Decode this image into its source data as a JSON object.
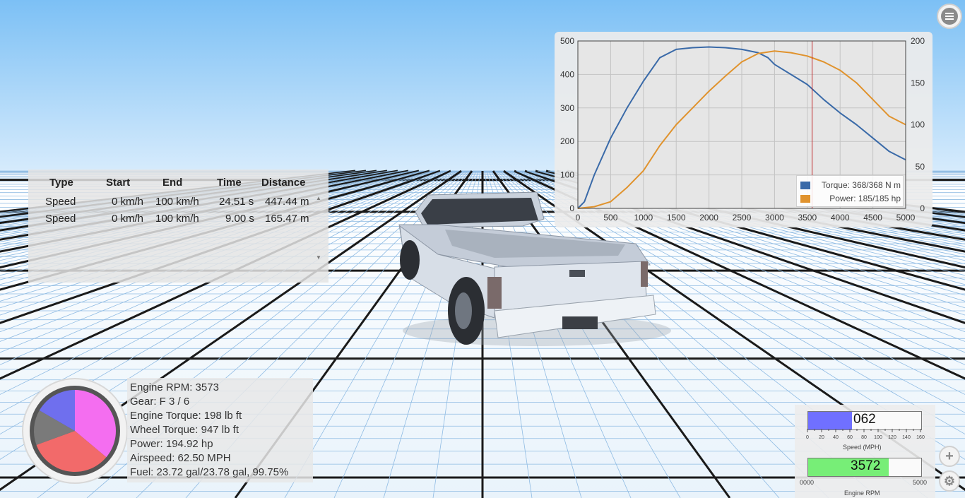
{
  "colors": {
    "sky_top": "#7cc0f5",
    "sky_bottom": "#cfe7fb",
    "ground": "#f2f8fd",
    "torque": "#3a6aa8",
    "power": "#e0932e",
    "speed_fill": "#7070ff",
    "rpm_fill": "#77ee77"
  },
  "menu": {
    "icon": "hamburger-menu-icon"
  },
  "torque_chart": {
    "chart_data": {
      "type": "line",
      "x_range": [
        0,
        5000
      ],
      "x_ticks": [
        "0",
        "500",
        "1000",
        "1500",
        "2000",
        "2500",
        "3000",
        "3500",
        "4000",
        "4500",
        "5000"
      ],
      "y_left_range": [
        0,
        500
      ],
      "y_left_ticks": [
        "0",
        "100",
        "200",
        "300",
        "400",
        "500"
      ],
      "y_right_range": [
        0,
        200
      ],
      "y_right_ticks": [
        "0",
        "50",
        "100",
        "150",
        "200"
      ],
      "grid": true,
      "marker_x": 3573,
      "legend_position": "bottom-right",
      "series": [
        {
          "name": "Torque: 368/368 N m",
          "axis": "left",
          "color": "#3a6aa8",
          "x": [
            0,
            100,
            250,
            500,
            750,
            1000,
            1250,
            1500,
            1750,
            2000,
            2250,
            2500,
            2750,
            2900,
            3000,
            3250,
            3500,
            3750,
            4000,
            4250,
            4500,
            4750,
            5000
          ],
          "y": [
            0,
            20,
            100,
            210,
            300,
            380,
            450,
            475,
            480,
            482,
            480,
            475,
            465,
            450,
            430,
            400,
            370,
            325,
            285,
            250,
            210,
            170,
            145
          ]
        },
        {
          "name": "Power: 185/185 hp",
          "axis": "right",
          "color": "#e0932e",
          "x": [
            0,
            250,
            500,
            750,
            1000,
            1250,
            1500,
            1750,
            2000,
            2250,
            2500,
            2750,
            3000,
            3250,
            3500,
            3750,
            4000,
            4250,
            4500,
            4750,
            5000
          ],
          "y": [
            0,
            2,
            8,
            25,
            45,
            75,
            100,
            120,
            140,
            158,
            175,
            185,
            188,
            186,
            182,
            175,
            165,
            150,
            130,
            110,
            100
          ]
        }
      ]
    }
  },
  "time_table": {
    "headers": [
      "Type",
      "Start",
      "End",
      "Time",
      "Distance"
    ],
    "rows": [
      [
        "Speed",
        "0 km/h",
        "100 km/h",
        "24.51 s",
        "447.44 m"
      ],
      [
        "Speed",
        "0 km/h",
        "100 km/h",
        "9.00 s",
        "165.47 m"
      ]
    ],
    "scroll_up_icon": "scroll-up-arrow-icon",
    "scroll_down_icon": "scroll-down-arrow-icon"
  },
  "engine_info": {
    "lines": [
      "Engine RPM: 3573",
      "Gear: F 3 / 6",
      "Engine Torque: 198 lb ft",
      "Wheel Torque: 947 lb ft",
      "Power: 194.92 hp",
      "Airspeed: 62.50 MPH",
      "Fuel: 23.72 gal/23.78 gal, 99.75%"
    ]
  },
  "gauge": {
    "slices": [
      {
        "color": "#f46ef0",
        "start": 0,
        "end": 130
      },
      {
        "color": "#f26a6a",
        "start": 130,
        "end": 250
      },
      {
        "color": "#7a7a7a",
        "start": 250,
        "end": 300
      },
      {
        "color": "#6f6fee",
        "start": 300,
        "end": 360
      }
    ]
  },
  "speedo": {
    "speed_value": "062",
    "speed_fraction": 0.3875,
    "speed_ticks": [
      "0",
      "20",
      "40",
      "60",
      "80",
      "100",
      "120",
      "140",
      "160"
    ],
    "speed_label": "Speed (MPH)",
    "rpm_value": "3572",
    "rpm_fraction": 0.7144,
    "rpm_min": "0000",
    "rpm_max": "5000",
    "rpm_label": "Engine RPM"
  },
  "side_buttons": {
    "add_icon": "plus-icon",
    "settings_icon": "gear-icon"
  }
}
